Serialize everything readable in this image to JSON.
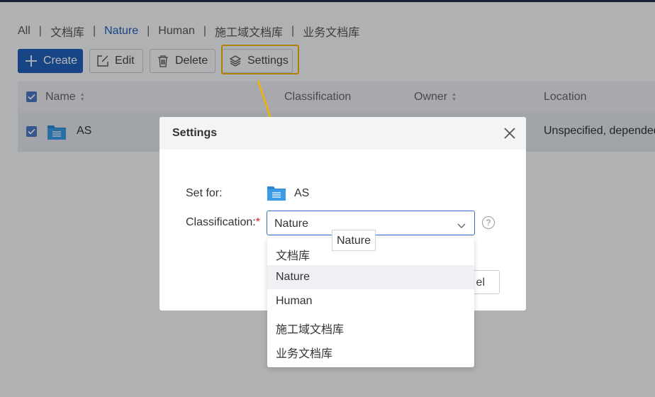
{
  "filters": {
    "items": [
      {
        "label": "All",
        "active": false
      },
      {
        "label": "文档库",
        "active": false
      },
      {
        "label": "Nature",
        "active": true
      },
      {
        "label": "Human",
        "active": false
      },
      {
        "label": "施工域文档库",
        "active": false
      },
      {
        "label": "业务文档库",
        "active": false
      }
    ],
    "separator": "|"
  },
  "toolbar": {
    "create_label": "Create",
    "edit_label": "Edit",
    "delete_label": "Delete",
    "settings_label": "Settings"
  },
  "table": {
    "columns": [
      "Name",
      "Classification",
      "Owner",
      "Location"
    ],
    "rows": [
      {
        "name": "AS",
        "classification": "",
        "owner": "",
        "location": "Unspecified, depended"
      }
    ]
  },
  "dialog": {
    "title": "Settings",
    "set_for_label": "Set for:",
    "set_for_value": "AS",
    "classification_label": "Classification:",
    "required_mark": "*",
    "classification_value": "Nature",
    "cancel_label": "Cancel",
    "cancel_visible_fragment": "el",
    "help_symbol": "?"
  },
  "dropdown": {
    "options": [
      "文档库",
      "Nature",
      "Human",
      "施工域文档库",
      "业务文档库"
    ],
    "hovered_index": 1
  },
  "tooltip": {
    "text": "Nature"
  },
  "colors": {
    "accent": "#1f5fb8",
    "highlight": "#f0b400",
    "required": "#e02020"
  }
}
